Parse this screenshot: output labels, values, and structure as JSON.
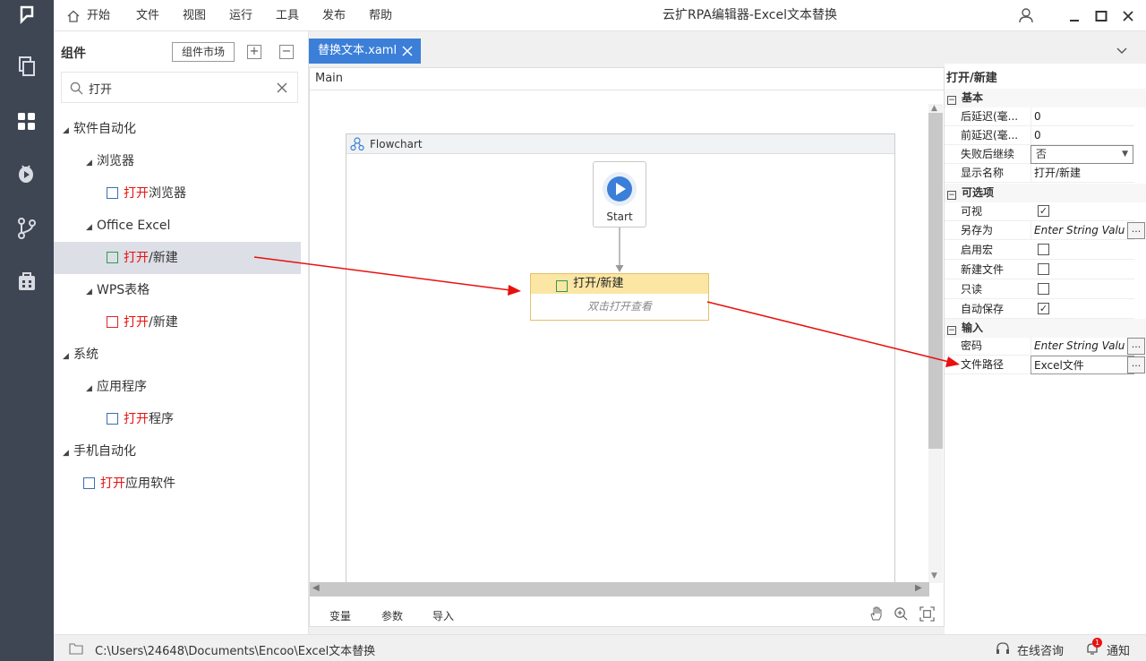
{
  "window": {
    "title": "云扩RPA编辑器-Excel文本替换"
  },
  "menu": {
    "home": "开始",
    "items": [
      "文件",
      "视图",
      "运行",
      "工具",
      "发布",
      "帮助"
    ]
  },
  "rail": {
    "icons": [
      "logo-icon",
      "copy-icon",
      "components-icon",
      "debug-icon",
      "branch-icon",
      "package-icon"
    ]
  },
  "components": {
    "title": "组件",
    "market_button": "组件市场",
    "search_value": "打开",
    "tree": [
      {
        "level": 0,
        "label": "软件自动化",
        "expanded": true
      },
      {
        "level": 1,
        "label": "浏览器",
        "expanded": true
      },
      {
        "level": 2,
        "match": "打开",
        "rest": "浏览器",
        "icon": "browser-open-icon"
      },
      {
        "level": 1,
        "label": "Office Excel",
        "expanded": true
      },
      {
        "level": 2,
        "match": "打开",
        "rest": "/新建",
        "icon": "excel-open-icon",
        "selected": true
      },
      {
        "level": 1,
        "label": "WPS表格",
        "expanded": true
      },
      {
        "level": 2,
        "match": "打开",
        "rest": "/新建",
        "icon": "wps-open-icon"
      },
      {
        "level": 0,
        "label": "系统",
        "expanded": true
      },
      {
        "level": 1,
        "label": "应用程序",
        "expanded": true
      },
      {
        "level": 2,
        "match": "打开",
        "rest": "程序",
        "icon": "program-open-icon"
      },
      {
        "level": 0,
        "label": "手机自动化",
        "expanded": true
      },
      {
        "level": 1,
        "match": "打开",
        "rest": "应用软件",
        "icon": "mobile-app-icon"
      }
    ]
  },
  "tab": {
    "label": "替换文本.xaml"
  },
  "designer": {
    "breadcrumb": "Main",
    "flowchart_label": "Flowchart",
    "start_label": "Start",
    "activity": {
      "title": "打开/新建",
      "hint": "双击打开查看"
    },
    "bottom_tabs": [
      "变量",
      "参数",
      "导入"
    ]
  },
  "properties": {
    "title": "打开/新建",
    "sections": [
      {
        "name": "基本",
        "rows": [
          {
            "label": "后延迟(毫...",
            "kind": "text",
            "value": "0"
          },
          {
            "label": "前延迟(毫...",
            "kind": "text",
            "value": "0"
          },
          {
            "label": "失败后继续",
            "kind": "select",
            "value": "否"
          },
          {
            "label": "显示名称",
            "kind": "text",
            "value": "打开/新建"
          }
        ]
      },
      {
        "name": "可选项",
        "rows": [
          {
            "label": "可视",
            "kind": "check",
            "checked": true
          },
          {
            "label": "另存为",
            "kind": "input",
            "placeholder": "Enter String Valu"
          },
          {
            "label": "启用宏",
            "kind": "check",
            "checked": false
          },
          {
            "label": "新建文件",
            "kind": "check",
            "checked": false
          },
          {
            "label": "只读",
            "kind": "check",
            "checked": false
          },
          {
            "label": "自动保存",
            "kind": "check",
            "checked": true
          }
        ]
      },
      {
        "name": "输入",
        "rows": [
          {
            "label": "密码",
            "kind": "input",
            "placeholder": "Enter String Valu"
          },
          {
            "label": "文件路径",
            "kind": "input",
            "value": "Excel文件"
          }
        ]
      }
    ]
  },
  "status": {
    "path": "C:\\Users\\24648\\Documents\\Encoo\\Excel文本替换",
    "consult": "在线咨询",
    "notify": "通知",
    "notify_count": "1"
  },
  "colors": {
    "accent": "#3b7fd8",
    "rail": "#3e4553",
    "highlight": "#e8110f",
    "activity_header": "#fbe6a4",
    "annotation_arrow": "#e8110f"
  }
}
